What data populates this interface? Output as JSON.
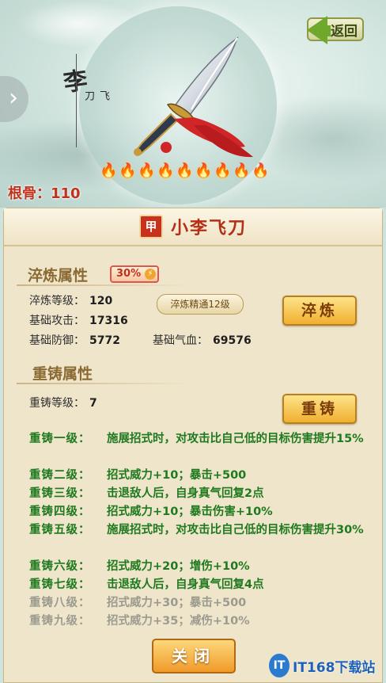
{
  "scene": {
    "calligraphy_main": "李",
    "calligraphy_sub": "飞刀",
    "back_label": "返回",
    "root_bone_label": "根骨：110",
    "flames": [
      {
        "state": "on"
      },
      {
        "state": "on"
      },
      {
        "state": "on"
      },
      {
        "state": "on"
      },
      {
        "state": "on"
      },
      {
        "state": "on"
      },
      {
        "state": "on"
      },
      {
        "state": "off"
      },
      {
        "state": "off"
      }
    ]
  },
  "panel": {
    "grade_badge": "甲",
    "item_name": "小李飞刀",
    "temper": {
      "title": "淬炼属性",
      "percent": "30%",
      "mastery": "淬炼精通12级",
      "button": "淬炼",
      "stats": {
        "level_label": "淬炼等级：",
        "level_value": "120",
        "atk_label": "基础攻击：",
        "atk_value": "17316",
        "def_label": "基础防御：",
        "def_value": "5772",
        "hp_label": "基础气血：",
        "hp_value": "69576"
      }
    },
    "recast": {
      "title": "重铸属性",
      "level_label": "重铸等级：",
      "level_value": "7",
      "button": "重铸",
      "lines": [
        {
          "level": "重铸一级：",
          "desc": "施展招式时，对攻击比自己低的目标伤害提升15%",
          "active": true
        },
        {
          "level": "重铸二级：",
          "desc": "招式威力+10；暴击+500",
          "active": true
        },
        {
          "level": "重铸三级：",
          "desc": "击退敌人后，自身真气回复2点",
          "active": true
        },
        {
          "level": "重铸四级：",
          "desc": "招式威力+10；暴击伤害+10%",
          "active": true
        },
        {
          "level": "重铸五级：",
          "desc": "施展招式时，对攻击比自己低的目标伤害提升30%",
          "active": true
        },
        {
          "level": "重铸六级：",
          "desc": "招式威力+20；增伤+10%",
          "active": true
        },
        {
          "level": "重铸七级：",
          "desc": "击退敌人后，自身真气回复4点",
          "active": true
        },
        {
          "level": "重铸八级：",
          "desc": "招式威力+30；暴击+500",
          "active": false
        },
        {
          "level": "重铸九级：",
          "desc": "招式威力+35；减伤+10%",
          "active": false
        }
      ]
    },
    "close_label": "关闭"
  },
  "watermark": {
    "logo": "IT",
    "text": "IT168下载站"
  }
}
